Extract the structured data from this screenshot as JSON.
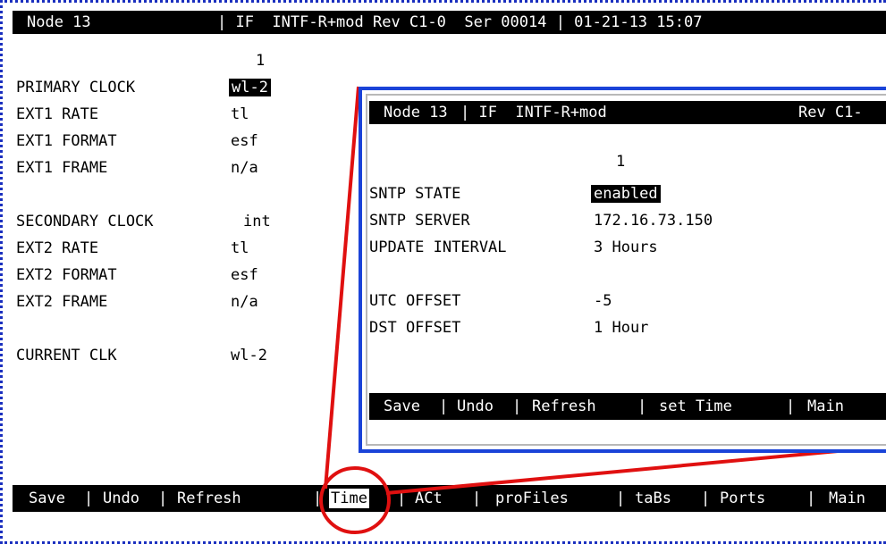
{
  "main": {
    "header": {
      "node": "Node 13",
      "interface": "| IF  INTF-R+mod Rev C1-0  Ser 00014 | 01-21-13 15:07"
    },
    "column_number": "1",
    "rows": [
      {
        "label": "PRIMARY CLOCK",
        "value": "wl-2"
      },
      {
        "label": "EXT1 RATE",
        "value": "tl"
      },
      {
        "label": "EXT1 FORMAT",
        "value": "esf"
      },
      {
        "label": "EXT1 FRAME",
        "value": "n/a"
      },
      {
        "label": "SECONDARY CLOCK",
        "value": "int"
      },
      {
        "label": "EXT2 RATE",
        "value": "tl"
      },
      {
        "label": "EXT2 FORMAT",
        "value": "esf"
      },
      {
        "label": "EXT2 FRAME",
        "value": "n/a"
      },
      {
        "label": "CURRENT CLK",
        "value": "wl-2"
      }
    ],
    "menu": [
      "Save",
      "Undo",
      "Refresh",
      "Time",
      "ACt",
      "proFiles",
      "taBs",
      "Ports",
      "Main"
    ],
    "separator": "|"
  },
  "popup": {
    "header": {
      "node": "Node 13",
      "interface": "| IF  INTF-R+mod",
      "rev": "Rev C1-"
    },
    "column_number": "1",
    "rows": [
      {
        "label": "SNTP STATE",
        "value": "enabled"
      },
      {
        "label": "SNTP SERVER",
        "value": "172.16.73.150"
      },
      {
        "label": "UPDATE INTERVAL",
        "value": "3 Hours"
      },
      {
        "label": "UTC OFFSET",
        "value": "-5"
      },
      {
        "label": "DST OFFSET",
        "value": "1 Hour"
      }
    ],
    "menu": [
      "Save",
      "Undo",
      "Refresh",
      "set Time",
      "Main"
    ]
  },
  "colors": {
    "callout": "#e01010",
    "popup_border": "#1a43d8",
    "terminal_border": "#1a2fbf"
  }
}
